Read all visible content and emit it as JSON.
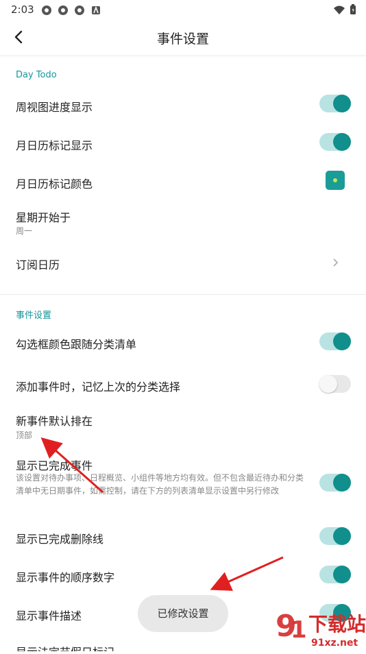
{
  "status": {
    "time": "2:03"
  },
  "appbar": {
    "title": "事件设置"
  },
  "section1": {
    "title": "Day Todo"
  },
  "rows1": [
    {
      "label": "周视图进度显示",
      "toggle": "on"
    },
    {
      "label": "月日历标记显示",
      "toggle": "on"
    },
    {
      "label": "月日历标记颜色"
    },
    {
      "label": "星期开始于",
      "sub": "周一"
    },
    {
      "label": "订阅日历"
    }
  ],
  "section2": {
    "title": "事件设置"
  },
  "rows2": [
    {
      "label": "勾选框颜色跟随分类清单",
      "toggle": "on"
    },
    {
      "label": "添加事件时，记忆上次的分类选择",
      "toggle": "off"
    },
    {
      "label": "新事件默认排在",
      "sub": "顶部"
    },
    {
      "label": "显示已完成事件",
      "desc": "该设置对待办事项、日程概览、小组件等地方均有效。但不包含最近待办和分类清单中无日期事件，如需控制，请在下方的列表清单显示设置中另行修改",
      "toggle": "on"
    },
    {
      "label": "显示已完成删除线",
      "toggle": "on"
    },
    {
      "label": "显示事件的顺序数字",
      "toggle": "on"
    },
    {
      "label": "显示事件描述",
      "toggle": "on"
    },
    {
      "label": "显示法定节假日标记"
    }
  ],
  "toast": {
    "text": "已修改设置"
  },
  "watermark": {
    "text1": "下载站",
    "text2": "91xz.net"
  },
  "colors": {
    "accent": "#118f8c",
    "section": "#16969b",
    "annotation": "#e02020"
  }
}
